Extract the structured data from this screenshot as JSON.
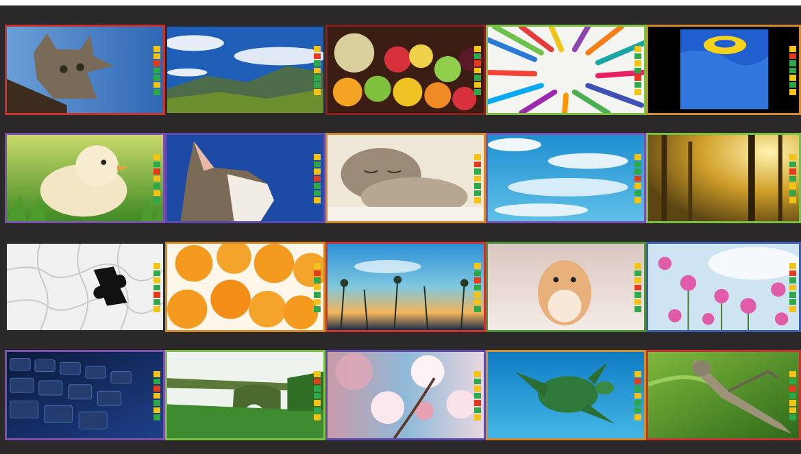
{
  "colors": {
    "background": "#2a2828",
    "meter_red": "#e23c1f",
    "meter_yellow": "#f2c417",
    "meter_green": "#2fa84a"
  },
  "tiles": [
    {
      "id": "cat-on-branch",
      "border": "#c8322f"
    },
    {
      "id": "mountain-sky",
      "border": "#2b2b2b"
    },
    {
      "id": "fruit-basket",
      "border": "#8a1f1f"
    },
    {
      "id": "pencil-heart",
      "border": "#7bc043"
    },
    {
      "id": "pool-float",
      "border": "#d58a2a"
    },
    {
      "id": "chick-in-grass",
      "border": "#7d4fb0"
    },
    {
      "id": "tabby-cat",
      "border": "#5e4aa8"
    },
    {
      "id": "sleeping-kitten",
      "border": "#d58a2a"
    },
    {
      "id": "blue-sky-clouds",
      "border": "#7d4fb0"
    },
    {
      "id": "forest-sunlight",
      "border": "#7bc043"
    },
    {
      "id": "puzzle-piece",
      "border": "#2b2b2b"
    },
    {
      "id": "oranges",
      "border": "#d58a2a"
    },
    {
      "id": "sunset-flowers",
      "border": "#c8322f"
    },
    {
      "id": "hamster",
      "border": "#4f8f3a"
    },
    {
      "id": "cosmos-flowers",
      "border": "#3b5fae"
    },
    {
      "id": "keyboard",
      "border": "#7d4fb0"
    },
    {
      "id": "bridge-greenery",
      "border": "#7bc043"
    },
    {
      "id": "cherry-blossoms",
      "border": "#5e4aa8"
    },
    {
      "id": "sea-turtle",
      "border": "#d58a2a"
    },
    {
      "id": "grasshopper",
      "border": "#c8322f"
    }
  ]
}
